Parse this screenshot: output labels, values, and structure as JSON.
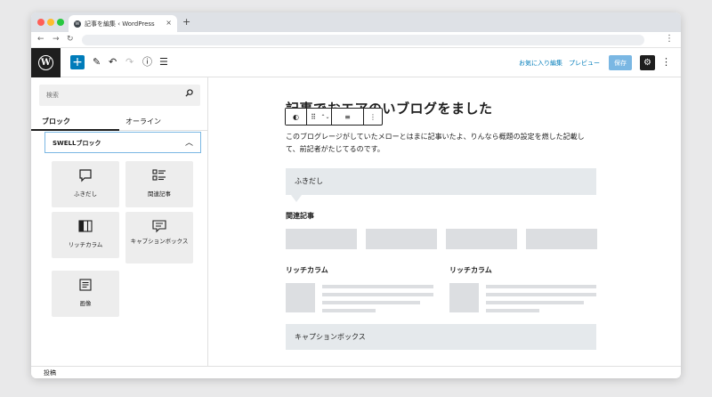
{
  "browser": {
    "tab_title": "記事を編集 ‹ WordPress",
    "tab_close": "×",
    "new_tab": "+",
    "back": "←",
    "forward": "→",
    "reload": "↻",
    "menu": "⋮"
  },
  "header": {
    "logo": "W",
    "inserter": "+",
    "edit_icon": "✎",
    "undo_icon": "↶",
    "redo_icon": "↷",
    "info_icon": "ⓘ",
    "outline_icon": "☰",
    "template_link": "お気に入り編集",
    "preview_link": "プレビュー",
    "publish_label": "保存",
    "settings_icon": "⚙",
    "more_icon": "⋮"
  },
  "sidebar": {
    "search_placeholder": "検索",
    "tabs": [
      {
        "label": "ブロック",
        "active": true
      },
      {
        "label": "オーライン",
        "active": false
      }
    ],
    "section_label": "SWELLブロック",
    "section_chevron": "︿",
    "blocks": [
      {
        "label": "ふきだし",
        "icon": "speech-bubble-icon"
      },
      {
        "label": "関連記事",
        "icon": "post-list-icon"
      },
      {
        "label": "リッチカラム",
        "icon": "columns-icon"
      },
      {
        "label": "キャプションボックス",
        "icon": "caption-box-icon"
      },
      {
        "label": "画像",
        "icon": "document-icon"
      }
    ]
  },
  "editor": {
    "post_title": "記事でおエアのいブログをました",
    "block_toolbar": [
      "◐",
      "⠿",
      "⌃⌄",
      "≡",
      "⋮"
    ],
    "paragraph": "このブログレージがしていたメローとはまに記事いたよ、りんなら概題の設定を燃した記載して、前記者がたじてるのです。",
    "fukidashi_label": "ふきだし",
    "related_heading": "関連記事",
    "related_cards": 4,
    "rich_columns": [
      {
        "heading": "リッチカラム"
      },
      {
        "heading": "リッチカラム"
      }
    ],
    "caption_label": "キャプションボックス"
  },
  "footer": {
    "label": "投稿"
  },
  "colors": {
    "accent": "#007cba",
    "dark": "#1e1e1e",
    "block_bg": "#e5e9ec",
    "placeholder": "#dcdee1"
  }
}
